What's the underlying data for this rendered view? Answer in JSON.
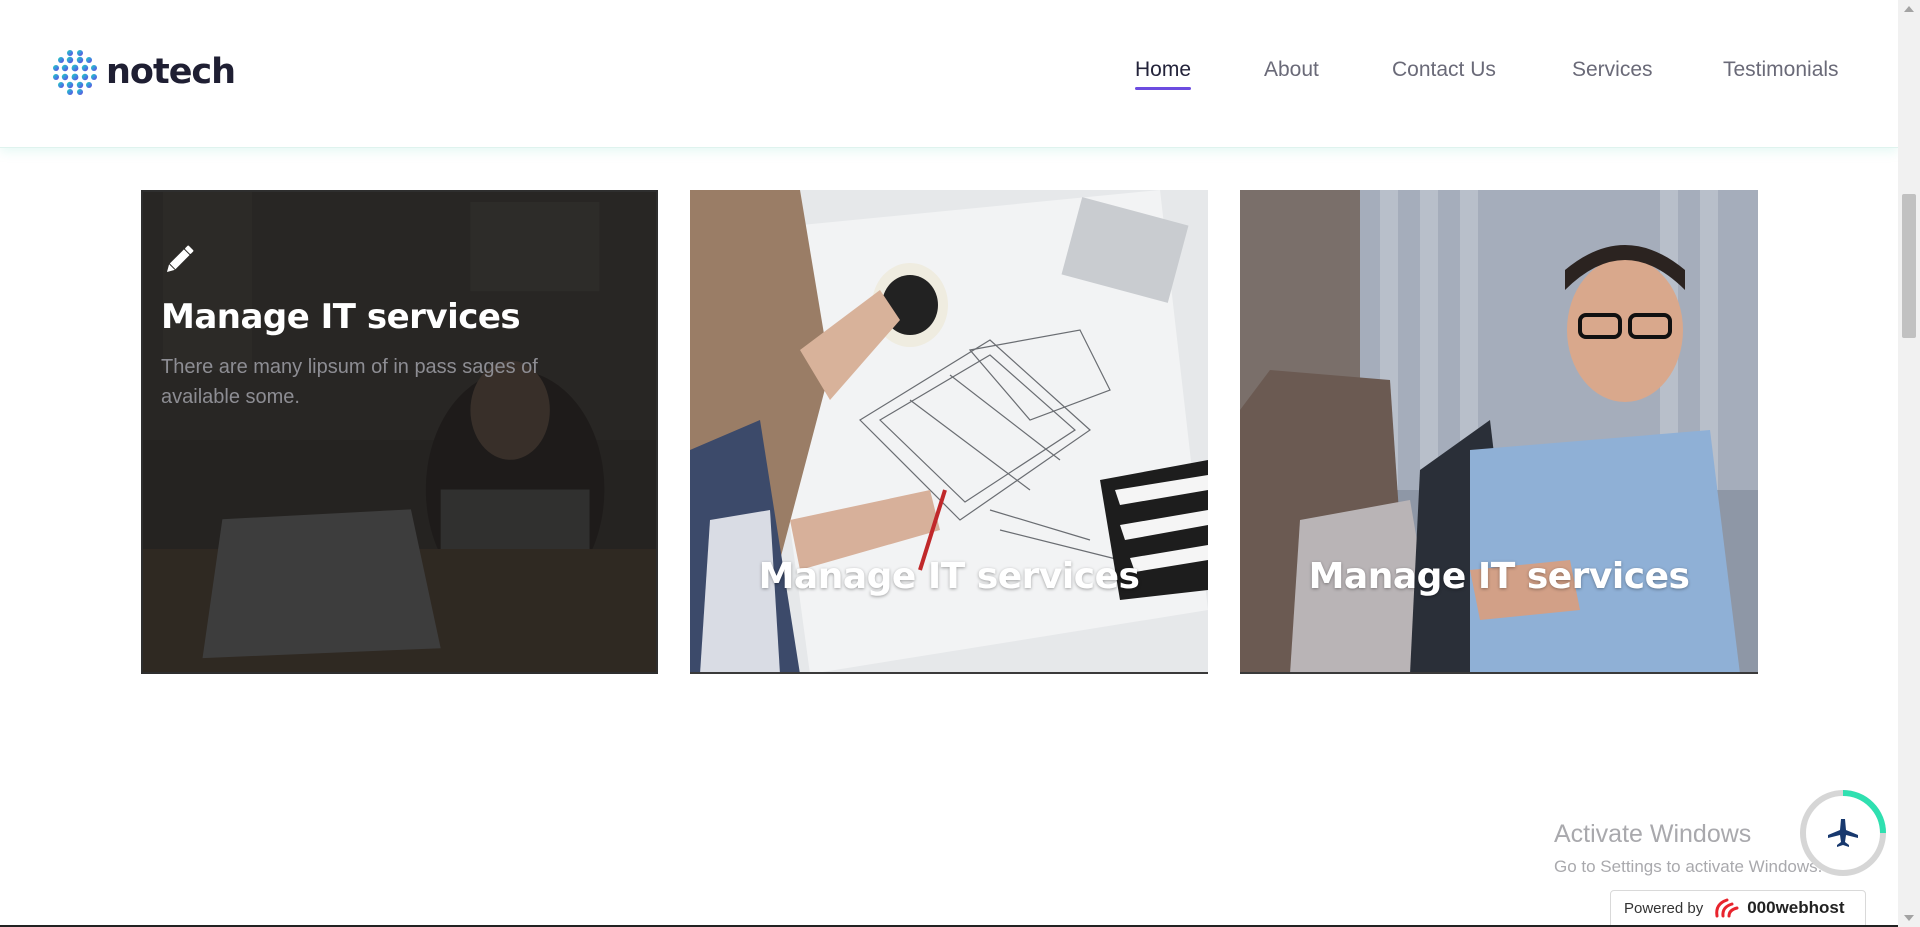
{
  "brand": {
    "name": "notech",
    "accent": "#6c4ce0"
  },
  "nav": {
    "items": [
      {
        "label": "Home",
        "active": true
      },
      {
        "label": "About",
        "active": false
      },
      {
        "label": "Contact Us",
        "active": false
      },
      {
        "label": "Services",
        "active": false
      },
      {
        "label": "Testimonials",
        "active": false
      }
    ]
  },
  "cards": [
    {
      "icon": "pencil-icon",
      "title": "Manage IT services",
      "description": "There are many lipsum of in pass sages of available some."
    },
    {
      "title": "Manage IT services"
    },
    {
      "title": "Manage IT services"
    }
  ],
  "watermark": {
    "line1": "Activate Windows",
    "line2": "Go to Settings to activate Windows."
  },
  "scroll_top": {
    "icon": "airplane-icon",
    "progress": 0.25,
    "accent": "#2fe0b0"
  },
  "powered_by": {
    "label": "Powered by",
    "host": "000webhost"
  }
}
